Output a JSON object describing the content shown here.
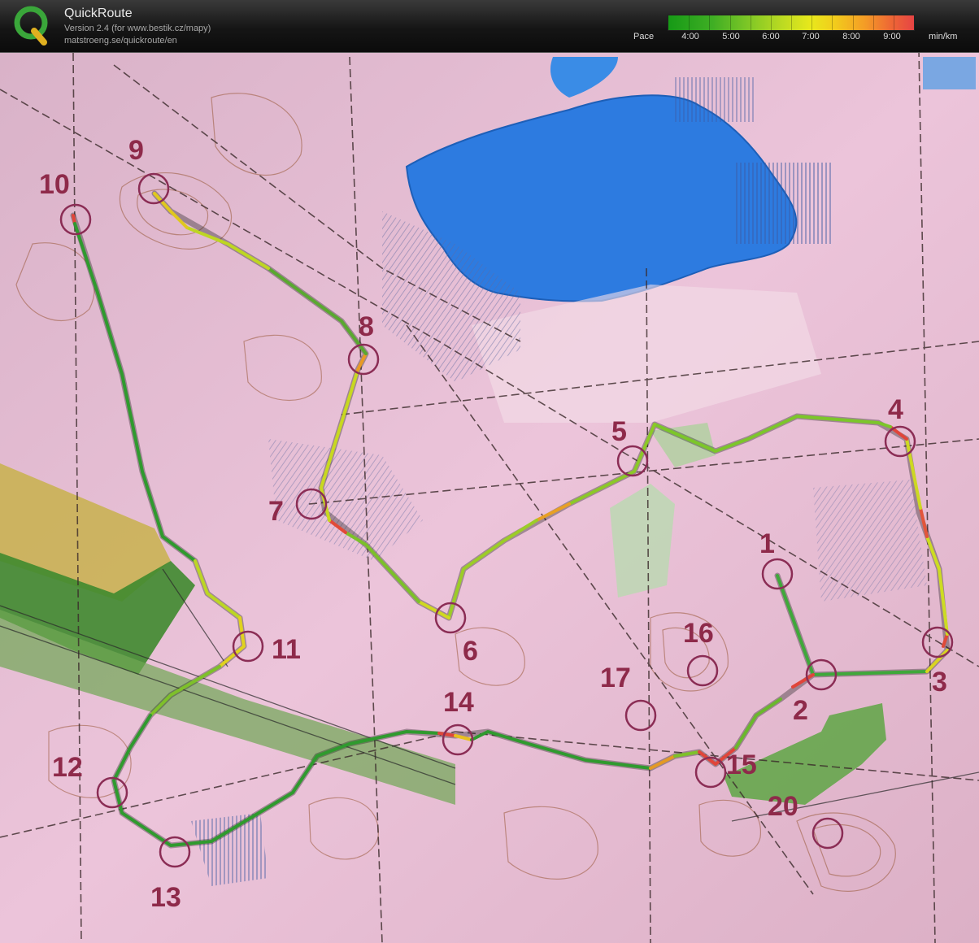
{
  "app": {
    "name": "QuickRoute",
    "version": "Version 2.4  (for www.bestik.cz/mapy)",
    "url": "matstroeng.se/quickroute/en",
    "logo_letter": "Q"
  },
  "pace_legend": {
    "label": "Pace",
    "ticks": [
      "4:00",
      "5:00",
      "6:00",
      "7:00",
      "8:00",
      "9:00"
    ],
    "unit": "min/km",
    "colors": {
      "fast": "#169a16",
      "medium": "#e8e81c",
      "slow": "#e64444"
    }
  },
  "map": {
    "controls": [
      {
        "number": "1"
      },
      {
        "number": "2"
      },
      {
        "number": "3"
      },
      {
        "number": "4"
      },
      {
        "number": "5"
      },
      {
        "number": "6"
      },
      {
        "number": "7"
      },
      {
        "number": "8"
      },
      {
        "number": "9"
      },
      {
        "number": "10"
      },
      {
        "number": "11"
      },
      {
        "number": "12"
      },
      {
        "number": "13"
      },
      {
        "number": "14"
      },
      {
        "number": "15"
      },
      {
        "number": "16"
      },
      {
        "number": "17"
      },
      {
        "number": "20"
      }
    ],
    "colors": {
      "paper": "#e8c0d6",
      "lake": "#2a78d8",
      "forest_green": "#4e9a3a",
      "yellow_field": "#c9b44a",
      "control": "#8b2d55"
    }
  }
}
